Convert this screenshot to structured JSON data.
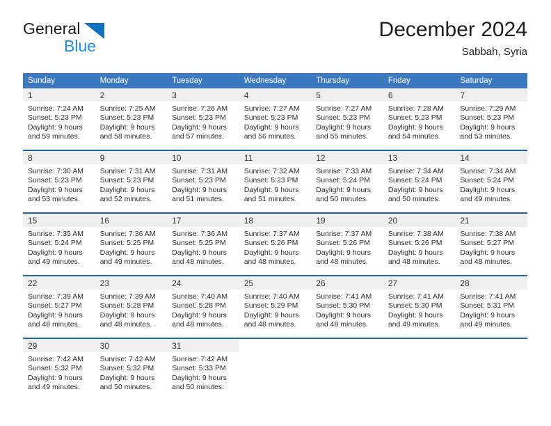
{
  "brand": {
    "name_dark": "General",
    "name_light": "Blue",
    "triangle_color": "#1271bd",
    "light_color": "#1f90e0"
  },
  "header": {
    "title": "December 2024",
    "location": "Sabbah, Syria"
  },
  "theme": {
    "header_blue": "#3b78bf",
    "row_divider_blue": "#1f63a8",
    "daynum_band": "#efefef"
  },
  "weekdays": [
    "Sunday",
    "Monday",
    "Tuesday",
    "Wednesday",
    "Thursday",
    "Friday",
    "Saturday"
  ],
  "weeks": [
    {
      "days": [
        {
          "num": "1",
          "sunrise": "Sunrise: 7:24 AM",
          "sunset": "Sunset: 5:23 PM",
          "daylight1": "Daylight: 9 hours",
          "daylight2": "and 59 minutes."
        },
        {
          "num": "2",
          "sunrise": "Sunrise: 7:25 AM",
          "sunset": "Sunset: 5:23 PM",
          "daylight1": "Daylight: 9 hours",
          "daylight2": "and 58 minutes."
        },
        {
          "num": "3",
          "sunrise": "Sunrise: 7:26 AM",
          "sunset": "Sunset: 5:23 PM",
          "daylight1": "Daylight: 9 hours",
          "daylight2": "and 57 minutes."
        },
        {
          "num": "4",
          "sunrise": "Sunrise: 7:27 AM",
          "sunset": "Sunset: 5:23 PM",
          "daylight1": "Daylight: 9 hours",
          "daylight2": "and 56 minutes."
        },
        {
          "num": "5",
          "sunrise": "Sunrise: 7:27 AM",
          "sunset": "Sunset: 5:23 PM",
          "daylight1": "Daylight: 9 hours",
          "daylight2": "and 55 minutes."
        },
        {
          "num": "6",
          "sunrise": "Sunrise: 7:28 AM",
          "sunset": "Sunset: 5:23 PM",
          "daylight1": "Daylight: 9 hours",
          "daylight2": "and 54 minutes."
        },
        {
          "num": "7",
          "sunrise": "Sunrise: 7:29 AM",
          "sunset": "Sunset: 5:23 PM",
          "daylight1": "Daylight: 9 hours",
          "daylight2": "and 53 minutes."
        }
      ]
    },
    {
      "days": [
        {
          "num": "8",
          "sunrise": "Sunrise: 7:30 AM",
          "sunset": "Sunset: 5:23 PM",
          "daylight1": "Daylight: 9 hours",
          "daylight2": "and 53 minutes."
        },
        {
          "num": "9",
          "sunrise": "Sunrise: 7:31 AM",
          "sunset": "Sunset: 5:23 PM",
          "daylight1": "Daylight: 9 hours",
          "daylight2": "and 52 minutes."
        },
        {
          "num": "10",
          "sunrise": "Sunrise: 7:31 AM",
          "sunset": "Sunset: 5:23 PM",
          "daylight1": "Daylight: 9 hours",
          "daylight2": "and 51 minutes."
        },
        {
          "num": "11",
          "sunrise": "Sunrise: 7:32 AM",
          "sunset": "Sunset: 5:23 PM",
          "daylight1": "Daylight: 9 hours",
          "daylight2": "and 51 minutes."
        },
        {
          "num": "12",
          "sunrise": "Sunrise: 7:33 AM",
          "sunset": "Sunset: 5:24 PM",
          "daylight1": "Daylight: 9 hours",
          "daylight2": "and 50 minutes."
        },
        {
          "num": "13",
          "sunrise": "Sunrise: 7:34 AM",
          "sunset": "Sunset: 5:24 PM",
          "daylight1": "Daylight: 9 hours",
          "daylight2": "and 50 minutes."
        },
        {
          "num": "14",
          "sunrise": "Sunrise: 7:34 AM",
          "sunset": "Sunset: 5:24 PM",
          "daylight1": "Daylight: 9 hours",
          "daylight2": "and 49 minutes."
        }
      ]
    },
    {
      "days": [
        {
          "num": "15",
          "sunrise": "Sunrise: 7:35 AM",
          "sunset": "Sunset: 5:24 PM",
          "daylight1": "Daylight: 9 hours",
          "daylight2": "and 49 minutes."
        },
        {
          "num": "16",
          "sunrise": "Sunrise: 7:36 AM",
          "sunset": "Sunset: 5:25 PM",
          "daylight1": "Daylight: 9 hours",
          "daylight2": "and 49 minutes."
        },
        {
          "num": "17",
          "sunrise": "Sunrise: 7:36 AM",
          "sunset": "Sunset: 5:25 PM",
          "daylight1": "Daylight: 9 hours",
          "daylight2": "and 48 minutes."
        },
        {
          "num": "18",
          "sunrise": "Sunrise: 7:37 AM",
          "sunset": "Sunset: 5:26 PM",
          "daylight1": "Daylight: 9 hours",
          "daylight2": "and 48 minutes."
        },
        {
          "num": "19",
          "sunrise": "Sunrise: 7:37 AM",
          "sunset": "Sunset: 5:26 PM",
          "daylight1": "Daylight: 9 hours",
          "daylight2": "and 48 minutes."
        },
        {
          "num": "20",
          "sunrise": "Sunrise: 7:38 AM",
          "sunset": "Sunset: 5:26 PM",
          "daylight1": "Daylight: 9 hours",
          "daylight2": "and 48 minutes."
        },
        {
          "num": "21",
          "sunrise": "Sunrise: 7:38 AM",
          "sunset": "Sunset: 5:27 PM",
          "daylight1": "Daylight: 9 hours",
          "daylight2": "and 48 minutes."
        }
      ]
    },
    {
      "days": [
        {
          "num": "22",
          "sunrise": "Sunrise: 7:39 AM",
          "sunset": "Sunset: 5:27 PM",
          "daylight1": "Daylight: 9 hours",
          "daylight2": "and 48 minutes."
        },
        {
          "num": "23",
          "sunrise": "Sunrise: 7:39 AM",
          "sunset": "Sunset: 5:28 PM",
          "daylight1": "Daylight: 9 hours",
          "daylight2": "and 48 minutes."
        },
        {
          "num": "24",
          "sunrise": "Sunrise: 7:40 AM",
          "sunset": "Sunset: 5:28 PM",
          "daylight1": "Daylight: 9 hours",
          "daylight2": "and 48 minutes."
        },
        {
          "num": "25",
          "sunrise": "Sunrise: 7:40 AM",
          "sunset": "Sunset: 5:29 PM",
          "daylight1": "Daylight: 9 hours",
          "daylight2": "and 48 minutes."
        },
        {
          "num": "26",
          "sunrise": "Sunrise: 7:41 AM",
          "sunset": "Sunset: 5:30 PM",
          "daylight1": "Daylight: 9 hours",
          "daylight2": "and 48 minutes."
        },
        {
          "num": "27",
          "sunrise": "Sunrise: 7:41 AM",
          "sunset": "Sunset: 5:30 PM",
          "daylight1": "Daylight: 9 hours",
          "daylight2": "and 49 minutes."
        },
        {
          "num": "28",
          "sunrise": "Sunrise: 7:41 AM",
          "sunset": "Sunset: 5:31 PM",
          "daylight1": "Daylight: 9 hours",
          "daylight2": "and 49 minutes."
        }
      ]
    },
    {
      "days": [
        {
          "num": "29",
          "sunrise": "Sunrise: 7:42 AM",
          "sunset": "Sunset: 5:32 PM",
          "daylight1": "Daylight: 9 hours",
          "daylight2": "and 49 minutes."
        },
        {
          "num": "30",
          "sunrise": "Sunrise: 7:42 AM",
          "sunset": "Sunset: 5:32 PM",
          "daylight1": "Daylight: 9 hours",
          "daylight2": "and 50 minutes."
        },
        {
          "num": "31",
          "sunrise": "Sunrise: 7:42 AM",
          "sunset": "Sunset: 5:33 PM",
          "daylight1": "Daylight: 9 hours",
          "daylight2": "and 50 minutes."
        },
        {
          "num": "",
          "sunrise": "",
          "sunset": "",
          "daylight1": "",
          "daylight2": ""
        },
        {
          "num": "",
          "sunrise": "",
          "sunset": "",
          "daylight1": "",
          "daylight2": ""
        },
        {
          "num": "",
          "sunrise": "",
          "sunset": "",
          "daylight1": "",
          "daylight2": ""
        },
        {
          "num": "",
          "sunrise": "",
          "sunset": "",
          "daylight1": "",
          "daylight2": ""
        }
      ]
    }
  ]
}
